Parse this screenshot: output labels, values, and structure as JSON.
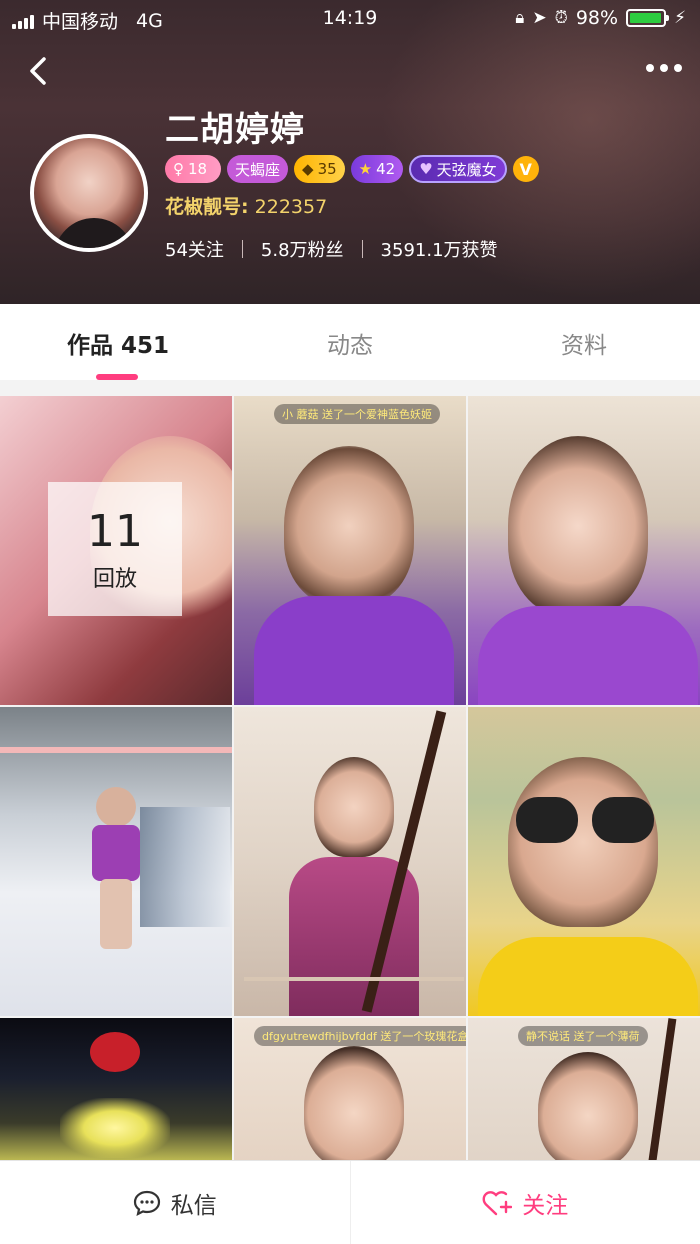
{
  "status_bar": {
    "carrier": "中国移动",
    "network": "4G",
    "time": "14:19",
    "battery": "98%",
    "battery_level": 0.98,
    "battery_color": "#2ecc40"
  },
  "profile": {
    "name": "二胡婷婷",
    "badges": {
      "gender_age": "18",
      "zodiac": "天蝎座",
      "diamond_level": "35",
      "star_level": "42",
      "title": "天弦魔女",
      "verified": "V"
    },
    "id_label": "花椒靓号:",
    "id_value": "222357",
    "following": "54关注",
    "fans": "5.8万粉丝",
    "likes": "3591.1万获赞"
  },
  "tabs": [
    {
      "label": "作品 451",
      "active": true
    },
    {
      "label": "动态",
      "active": false
    },
    {
      "label": "资料",
      "active": false
    }
  ],
  "grid": {
    "replay_count": "11",
    "replay_label": "回放",
    "gift_notes": [
      "小 蘑菇 送了一个爱神蓝色妖姬",
      "dfgyutrewdfhijbvfddf 送了一个玫瑰花盒",
      "静不说话 送了一个薄荷"
    ]
  },
  "bottom_bar": {
    "message_label": "私信",
    "follow_label": "关注",
    "accent_color": "#ff3d7f"
  }
}
